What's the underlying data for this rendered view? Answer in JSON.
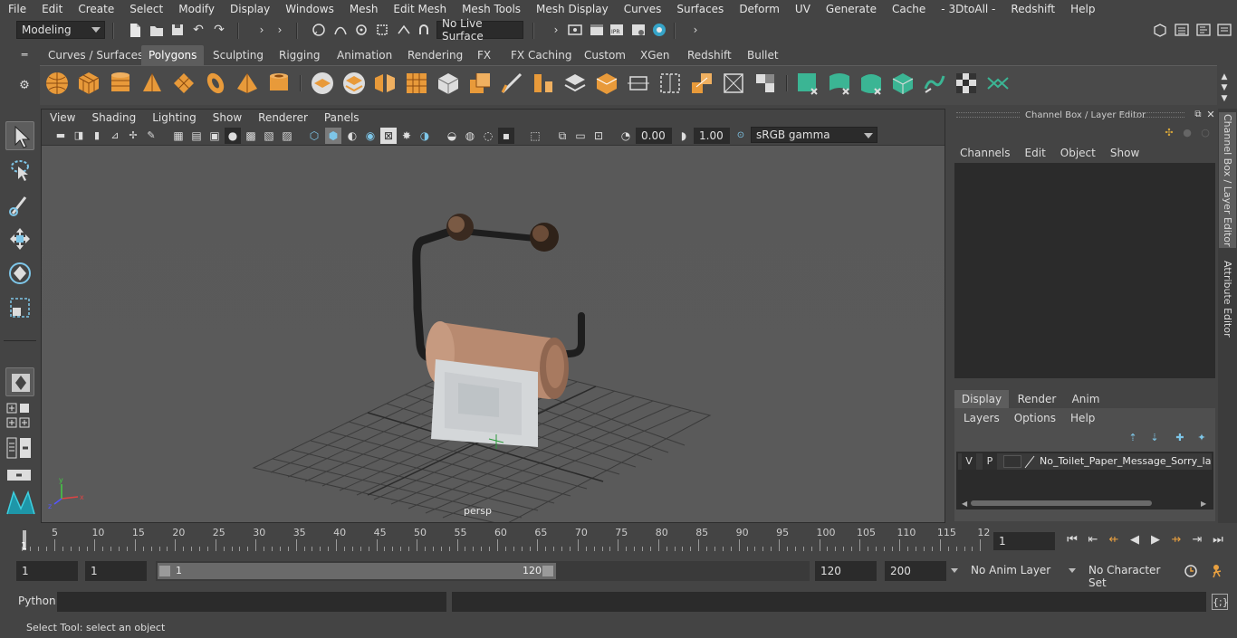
{
  "menubar": {
    "items": [
      "File",
      "Edit",
      "Create",
      "Select",
      "Modify",
      "Display",
      "Windows",
      "Mesh",
      "Edit Mesh",
      "Mesh Tools",
      "Mesh Display",
      "Curves",
      "Surfaces",
      "Deform",
      "UV",
      "Generate",
      "Cache",
      "- 3DtoAll -",
      "Redshift",
      "Help"
    ]
  },
  "statusline": {
    "workspace": "Modeling",
    "live_surface": "No Live Surface"
  },
  "shelf": {
    "tabs": [
      "Curves / Surfaces",
      "Polygons",
      "Sculpting",
      "Rigging",
      "Animation",
      "Rendering",
      "FX",
      "FX Caching",
      "Custom",
      "XGen",
      "Redshift",
      "Bullet"
    ],
    "active_tab": "Polygons"
  },
  "viewport": {
    "menu": [
      "View",
      "Shading",
      "Lighting",
      "Show",
      "Renderer",
      "Panels"
    ],
    "exposure": "0.00",
    "gamma": "1.00",
    "color_space": "sRGB gamma",
    "camera_label": "persp"
  },
  "channelbox": {
    "title": "Channel Box / Layer Editor",
    "menu": [
      "Channels",
      "Edit",
      "Object",
      "Show"
    ],
    "layer_tabs": [
      "Display",
      "Render",
      "Anim"
    ],
    "active_layer_tab": "Display",
    "layer_menu": [
      "Layers",
      "Options",
      "Help"
    ],
    "layer": {
      "v": "V",
      "p": "P",
      "name": "No_Toilet_Paper_Message_Sorry_laye"
    }
  },
  "sidetabs": [
    "Channel Box / Layer Editor",
    "Attribute Editor"
  ],
  "timeslider": {
    "ticks": [
      "5",
      "10",
      "15",
      "20",
      "25",
      "30",
      "35",
      "40",
      "45",
      "50",
      "55",
      "60",
      "65",
      "70",
      "75",
      "80",
      "85",
      "90",
      "95",
      "100",
      "105",
      "110",
      "115",
      "12"
    ],
    "start_label": "1",
    "current_frame": "1"
  },
  "rangeslider": {
    "start": "1",
    "start2": "1",
    "range_start": "1",
    "range_end": "120",
    "end": "120",
    "end2": "200",
    "anim_layer": "No Anim Layer",
    "character_set": "No Character Set"
  },
  "cmdline": {
    "label": "Python"
  },
  "helpline": {
    "text": "Select Tool: select an object"
  }
}
